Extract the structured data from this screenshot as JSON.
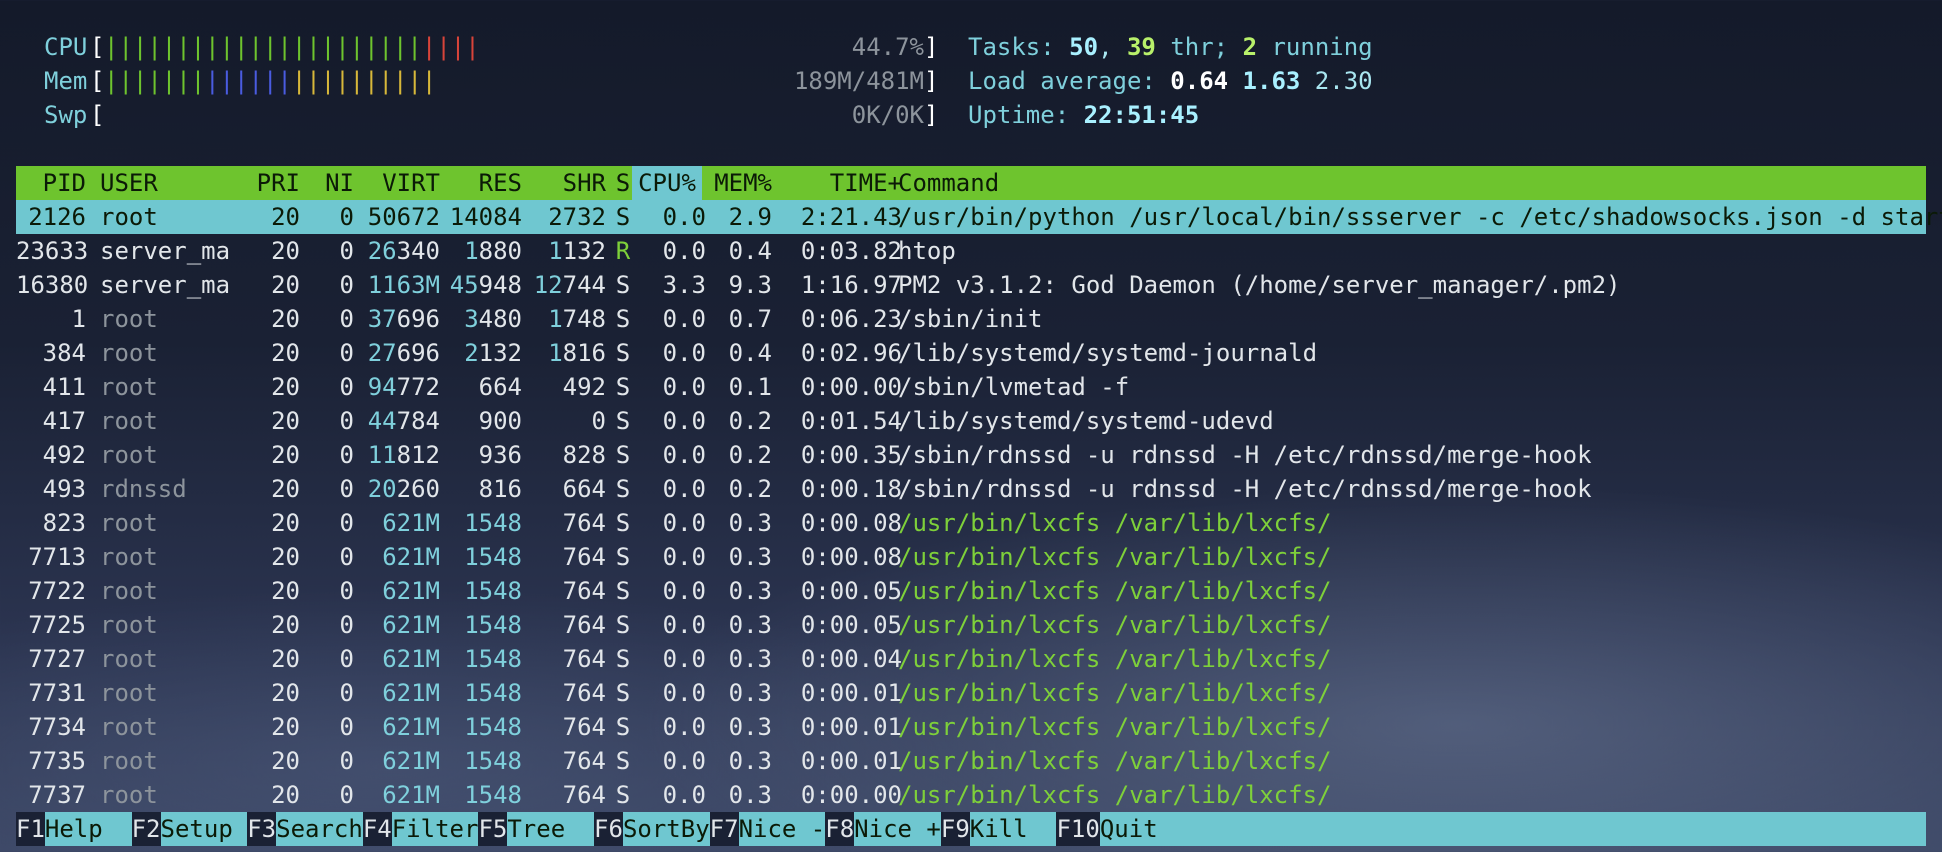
{
  "meters": {
    "cpu": {
      "label": "CPU",
      "value": "44.7%",
      "fraction": 0.447
    },
    "mem": {
      "label": "Mem",
      "value": "189M/481M",
      "fraction": 0.393
    },
    "swp": {
      "label": "Swp",
      "value": "0K/0K",
      "fraction": 0.0
    }
  },
  "info": {
    "tasks_label": "Tasks:",
    "tasks": "50",
    "threads": "39",
    "thr_label": "thr;",
    "running": "2",
    "running_label": "running",
    "load_label": "Load average:",
    "load1": "0.64",
    "load5": "1.63",
    "load15": "2.30",
    "uptime_label": "Uptime:",
    "uptime": "22:51:45"
  },
  "table": {
    "headers": [
      "PID",
      "USER",
      "PRI",
      "NI",
      "VIRT",
      "RES",
      "SHR",
      "S",
      "CPU%",
      "MEM%",
      "TIME+",
      "Command"
    ],
    "sorted_column": "CPU%",
    "rows": [
      {
        "pid": "2126",
        "user": "root",
        "pri": "20",
        "ni": "0",
        "virt": "50672",
        "res": "14084",
        "shr": "2732",
        "s": "S",
        "cpu": "0.0",
        "mem": "2.9",
        "time": "2:21.43",
        "cmd": "/usr/bin/python /usr/local/bin/ssserver -c /etc/shadowsocks.json -d start",
        "selected": true
      },
      {
        "pid": "23633",
        "user": "server_ma",
        "pri": "20",
        "ni": "0",
        "virt": "26340",
        "res": "1880",
        "shr": "1132",
        "s": "R",
        "cpu": "0.0",
        "mem": "0.4",
        "time": "0:03.82",
        "cmd": "htop"
      },
      {
        "pid": "16380",
        "user": "server_ma",
        "pri": "20",
        "ni": "0",
        "virt": "1163M",
        "res": "45948",
        "shr": "12744",
        "s": "S",
        "cpu": "3.3",
        "mem": "9.3",
        "time": "1:16.97",
        "cmd": "PM2 v3.1.2: God Daemon (/home/server_manager/.pm2)"
      },
      {
        "pid": "1",
        "user": "root",
        "pri": "20",
        "ni": "0",
        "virt": "37696",
        "res": "3480",
        "shr": "1748",
        "s": "S",
        "cpu": "0.0",
        "mem": "0.7",
        "time": "0:06.23",
        "cmd": "/sbin/init"
      },
      {
        "pid": "384",
        "user": "root",
        "pri": "20",
        "ni": "0",
        "virt": "27696",
        "res": "2132",
        "shr": "1816",
        "s": "S",
        "cpu": "0.0",
        "mem": "0.4",
        "time": "0:02.96",
        "cmd": "/lib/systemd/systemd-journald"
      },
      {
        "pid": "411",
        "user": "root",
        "pri": "20",
        "ni": "0",
        "virt": "94772",
        "res": "664",
        "shr": "492",
        "s": "S",
        "cpu": "0.0",
        "mem": "0.1",
        "time": "0:00.00",
        "cmd": "/sbin/lvmetad -f"
      },
      {
        "pid": "417",
        "user": "root",
        "pri": "20",
        "ni": "0",
        "virt": "44784",
        "res": "900",
        "shr": "0",
        "s": "S",
        "cpu": "0.0",
        "mem": "0.2",
        "time": "0:01.54",
        "cmd": "/lib/systemd/systemd-udevd"
      },
      {
        "pid": "492",
        "user": "root",
        "pri": "20",
        "ni": "0",
        "virt": "11812",
        "res": "936",
        "shr": "828",
        "s": "S",
        "cpu": "0.0",
        "mem": "0.2",
        "time": "0:00.35",
        "cmd": "/sbin/rdnssd -u rdnssd -H /etc/rdnssd/merge-hook"
      },
      {
        "pid": "493",
        "user": "rdnssd",
        "pri": "20",
        "ni": "0",
        "virt": "20260",
        "res": "816",
        "shr": "664",
        "s": "S",
        "cpu": "0.0",
        "mem": "0.2",
        "time": "0:00.18",
        "cmd": "/sbin/rdnssd -u rdnssd -H /etc/rdnssd/merge-hook"
      },
      {
        "pid": "823",
        "user": "root",
        "pri": "20",
        "ni": "0",
        "virt": "621M",
        "res": "1548",
        "shr": "764",
        "s": "S",
        "cpu": "0.0",
        "mem": "0.3",
        "time": "0:00.08",
        "cmd": "/usr/bin/lxcfs /var/lib/lxcfs/",
        "thread": true
      },
      {
        "pid": "7713",
        "user": "root",
        "pri": "20",
        "ni": "0",
        "virt": "621M",
        "res": "1548",
        "shr": "764",
        "s": "S",
        "cpu": "0.0",
        "mem": "0.3",
        "time": "0:00.08",
        "cmd": "/usr/bin/lxcfs /var/lib/lxcfs/",
        "thread": true
      },
      {
        "pid": "7722",
        "user": "root",
        "pri": "20",
        "ni": "0",
        "virt": "621M",
        "res": "1548",
        "shr": "764",
        "s": "S",
        "cpu": "0.0",
        "mem": "0.3",
        "time": "0:00.05",
        "cmd": "/usr/bin/lxcfs /var/lib/lxcfs/",
        "thread": true
      },
      {
        "pid": "7725",
        "user": "root",
        "pri": "20",
        "ni": "0",
        "virt": "621M",
        "res": "1548",
        "shr": "764",
        "s": "S",
        "cpu": "0.0",
        "mem": "0.3",
        "time": "0:00.05",
        "cmd": "/usr/bin/lxcfs /var/lib/lxcfs/",
        "thread": true
      },
      {
        "pid": "7727",
        "user": "root",
        "pri": "20",
        "ni": "0",
        "virt": "621M",
        "res": "1548",
        "shr": "764",
        "s": "S",
        "cpu": "0.0",
        "mem": "0.3",
        "time": "0:00.04",
        "cmd": "/usr/bin/lxcfs /var/lib/lxcfs/",
        "thread": true
      },
      {
        "pid": "7731",
        "user": "root",
        "pri": "20",
        "ni": "0",
        "virt": "621M",
        "res": "1548",
        "shr": "764",
        "s": "S",
        "cpu": "0.0",
        "mem": "0.3",
        "time": "0:00.01",
        "cmd": "/usr/bin/lxcfs /var/lib/lxcfs/",
        "thread": true
      },
      {
        "pid": "7734",
        "user": "root",
        "pri": "20",
        "ni": "0",
        "virt": "621M",
        "res": "1548",
        "shr": "764",
        "s": "S",
        "cpu": "0.0",
        "mem": "0.3",
        "time": "0:00.01",
        "cmd": "/usr/bin/lxcfs /var/lib/lxcfs/",
        "thread": true
      },
      {
        "pid": "7735",
        "user": "root",
        "pri": "20",
        "ni": "0",
        "virt": "621M",
        "res": "1548",
        "shr": "764",
        "s": "S",
        "cpu": "0.0",
        "mem": "0.3",
        "time": "0:00.01",
        "cmd": "/usr/bin/lxcfs /var/lib/lxcfs/",
        "thread": true
      },
      {
        "pid": "7737",
        "user": "root",
        "pri": "20",
        "ni": "0",
        "virt": "621M",
        "res": "1548",
        "shr": "764",
        "s": "S",
        "cpu": "0.0",
        "mem": "0.3",
        "time": "0:00.00",
        "cmd": "/usr/bin/lxcfs /var/lib/lxcfs/",
        "thread": true
      }
    ]
  },
  "footer": [
    {
      "key": "F1",
      "label": "Help  "
    },
    {
      "key": "F2",
      "label": "Setup "
    },
    {
      "key": "F3",
      "label": "Search"
    },
    {
      "key": "F4",
      "label": "Filter"
    },
    {
      "key": "F5",
      "label": "Tree  "
    },
    {
      "key": "F6",
      "label": "SortBy"
    },
    {
      "key": "F7",
      "label": "Nice -"
    },
    {
      "key": "F8",
      "label": "Nice +"
    },
    {
      "key": "F9",
      "label": "Kill  "
    },
    {
      "key": "F10",
      "label": "Quit"
    }
  ],
  "colors": {
    "header_bg": "#6ec42e",
    "selected_bg": "#6fc7d0",
    "accent_cyan": "#7fd0dc",
    "thread_green": "#7ed03a",
    "bar_green": "#6ec42e",
    "bar_red": "#d8443a",
    "bar_blue": "#4a5ce0",
    "bar_yellow": "#d7b83a"
  }
}
